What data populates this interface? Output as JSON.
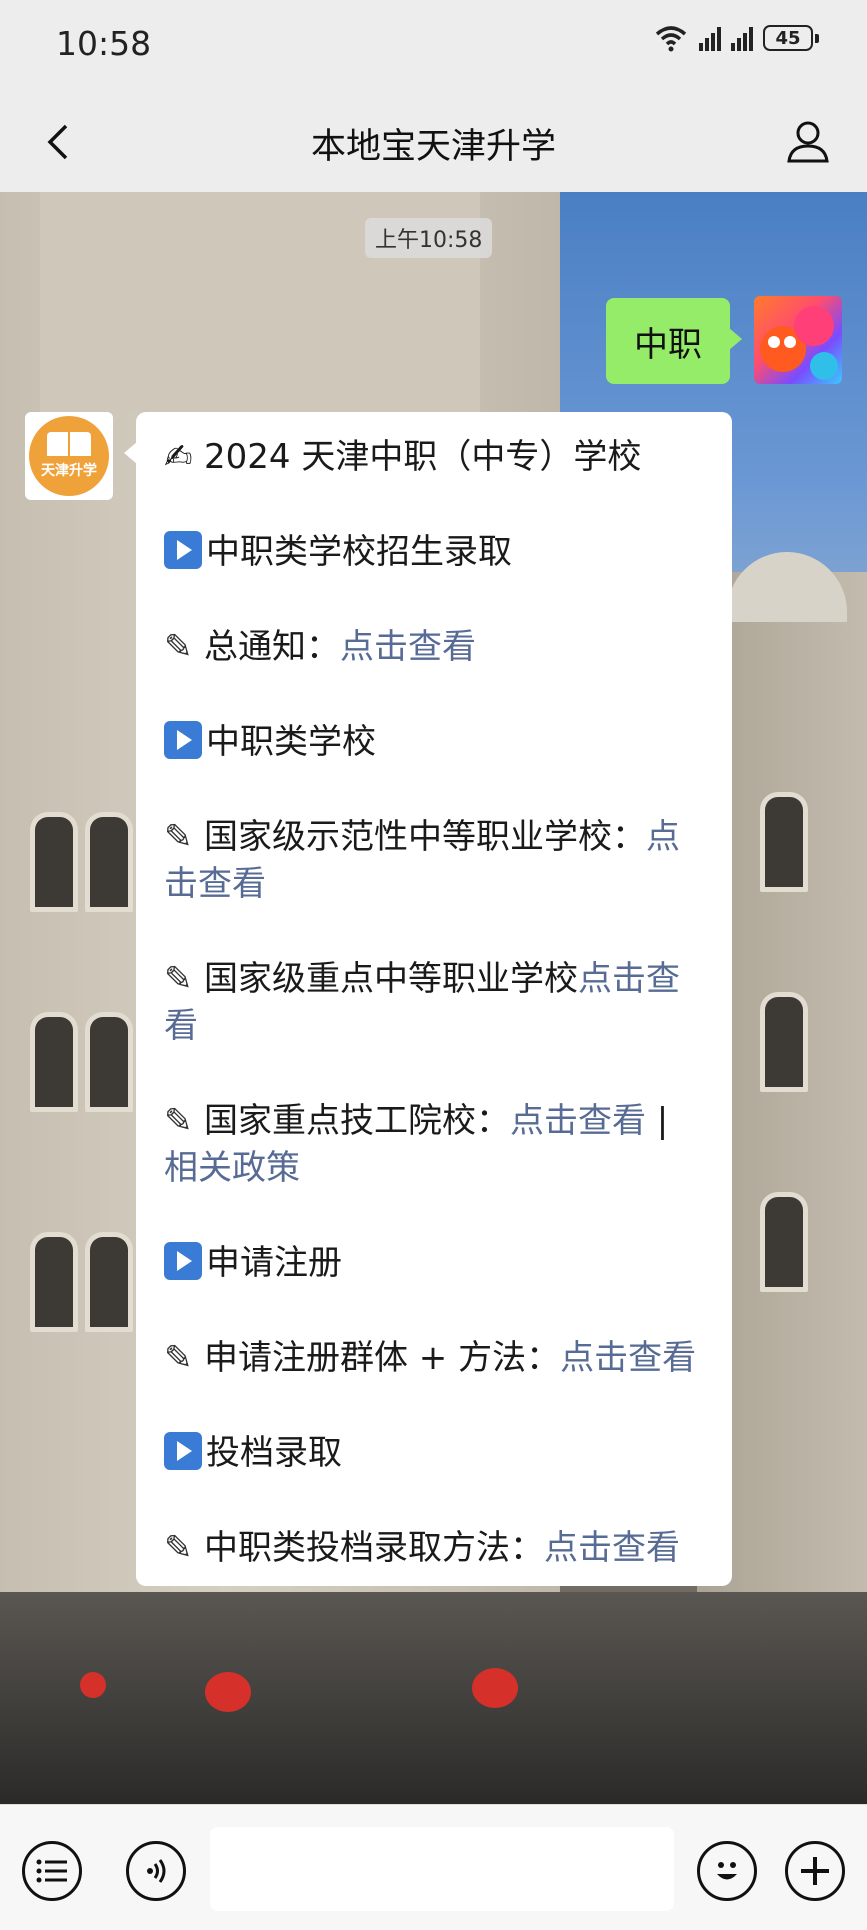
{
  "status_bar": {
    "time": "10:58",
    "battery": "45"
  },
  "header": {
    "title": "本地宝天津升学"
  },
  "chat": {
    "timestamp": "上午10:58",
    "user_message": "中职",
    "bot_avatar_label": "天津升学",
    "bot_lines": [
      {
        "icon": "writing-hand",
        "text": "2024 天津中职（中专）学校",
        "link": ""
      },
      {
        "icon": "play-button",
        "text": "中职类学校招生录取",
        "link": ""
      },
      {
        "icon": "pencil",
        "text": "总通知：",
        "link": "点击查看"
      },
      {
        "icon": "play-button",
        "text": "中职类学校",
        "link": ""
      },
      {
        "icon": "pencil",
        "text": "国家级示范性中等职业学校：",
        "link": "点击查看"
      },
      {
        "icon": "pencil",
        "text": "国家级重点中等职业学校",
        "link": "点击查看"
      },
      {
        "icon": "pencil",
        "text": "国家重点技工院校：",
        "link": "点击查看",
        "sep": " | ",
        "link2": "相关政策"
      },
      {
        "icon": "play-button",
        "text": "申请注册",
        "link": ""
      },
      {
        "icon": "pencil",
        "text": "申请注册群体 + 方法：",
        "link": "点击查看"
      },
      {
        "icon": "play-button",
        "text": "投档录取",
        "link": ""
      },
      {
        "icon": "pencil",
        "text": "中职类投档录取方法：",
        "link": "点击查看"
      }
    ]
  },
  "colors": {
    "user_bubble": "#95ec69",
    "link": "#576b95",
    "background": "#ededed"
  }
}
